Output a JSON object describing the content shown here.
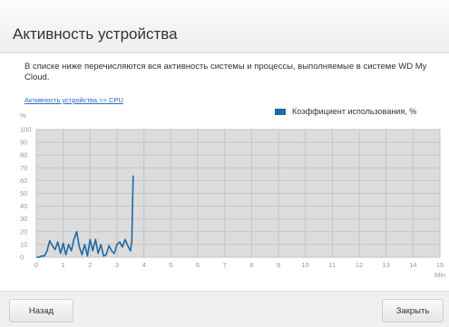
{
  "dialog": {
    "title": "Активность устройства",
    "description": "В списке ниже перечисляются вся активность системы и процессы, выполняемые в системе WD My Cloud.",
    "breadcrumb": "Активность устройства >> CPU",
    "back_label": "Назад",
    "close_label": "Закрыть"
  },
  "colors": {
    "series": "#1f6aa3",
    "plot_background": "#dcdcdc",
    "grid": "#c4c4c4"
  },
  "chart_data": {
    "type": "line",
    "ylabel": "%",
    "xlabel": "Min",
    "ylim": [
      0,
      100
    ],
    "xlim": [
      0,
      15
    ],
    "y_ticks": [
      100,
      90,
      80,
      70,
      60,
      50,
      40,
      30,
      20,
      10,
      0
    ],
    "x_ticks": [
      0,
      1,
      2,
      3,
      4,
      5,
      6,
      7,
      8,
      9,
      10,
      11,
      12,
      13,
      14,
      15
    ],
    "grid": true,
    "legend_position": "top-right",
    "series": [
      {
        "name": "Коэффициент использования, %",
        "x": [
          0,
          0.1,
          0.2,
          0.3,
          0.4,
          0.5,
          0.6,
          0.7,
          0.8,
          0.9,
          1.0,
          1.1,
          1.2,
          1.3,
          1.4,
          1.5,
          1.6,
          1.7,
          1.8,
          1.9,
          2.0,
          2.1,
          2.2,
          2.3,
          2.4,
          2.5,
          2.6,
          2.7,
          2.8,
          2.9,
          3.0,
          3.1,
          3.2,
          3.3,
          3.4,
          3.5,
          3.55,
          3.6
        ],
        "values": [
          0,
          0,
          1,
          1,
          5,
          13,
          9,
          6,
          12,
          3,
          11,
          2,
          10,
          5,
          14,
          20,
          8,
          2,
          10,
          1,
          14,
          5,
          14,
          3,
          10,
          1,
          2,
          9,
          5,
          3,
          10,
          12,
          8,
          14,
          9,
          5,
          12,
          64
        ]
      }
    ]
  }
}
